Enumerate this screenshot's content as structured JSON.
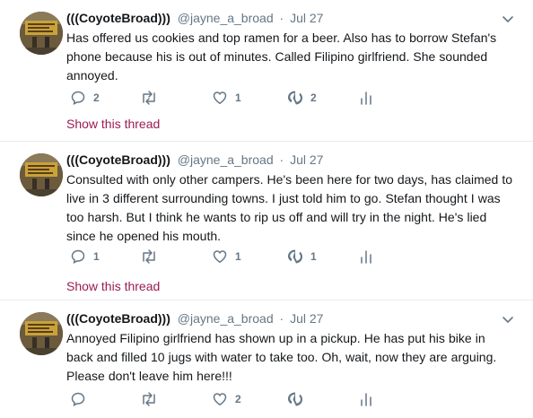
{
  "tweets": [
    {
      "name": "(((CoyoteBroad)))",
      "handle": "@jayne_a_broad",
      "separator": "·",
      "date": "Jul 27",
      "text": "Has offered us cookies and top ramen for a beer. Also has to borrow Stefan's phone because his is out of minutes. Called Filipino girlfriend. She sounded annoyed.",
      "replies": "2",
      "retweets": "",
      "likes": "1",
      "stat_count": "2",
      "thread_link": "Show this thread"
    },
    {
      "name": "(((CoyoteBroad)))",
      "handle": "@jayne_a_broad",
      "separator": "·",
      "date": "Jul 27",
      "text": "Consulted with only other campers. He's been here for two days, has claimed to live in 3 different surrounding towns. I just told him to go. Stefan thought I was too harsh. But I think he wants to rip us off and will try in the night. He's lied since he opened his mouth.",
      "replies": "1",
      "retweets": "",
      "likes": "1",
      "stat_count": "1",
      "thread_link": "Show this thread"
    },
    {
      "name": "(((CoyoteBroad)))",
      "handle": "@jayne_a_broad",
      "separator": "·",
      "date": "Jul 27",
      "text": "Annoyed Filipino girlfriend has shown up in a pickup. He has put his bike in back and filled 10 jugs with water to take too. Oh, wait, now they are arguing. Please don't leave him here!!!",
      "replies": "",
      "retweets": "",
      "likes": "2",
      "stat_count": "",
      "thread_link": ""
    }
  ],
  "colors": {
    "text": "#14171a",
    "secondary": "#657786",
    "thread_link": "#9b1c50",
    "divider": "#e6ecf0"
  }
}
